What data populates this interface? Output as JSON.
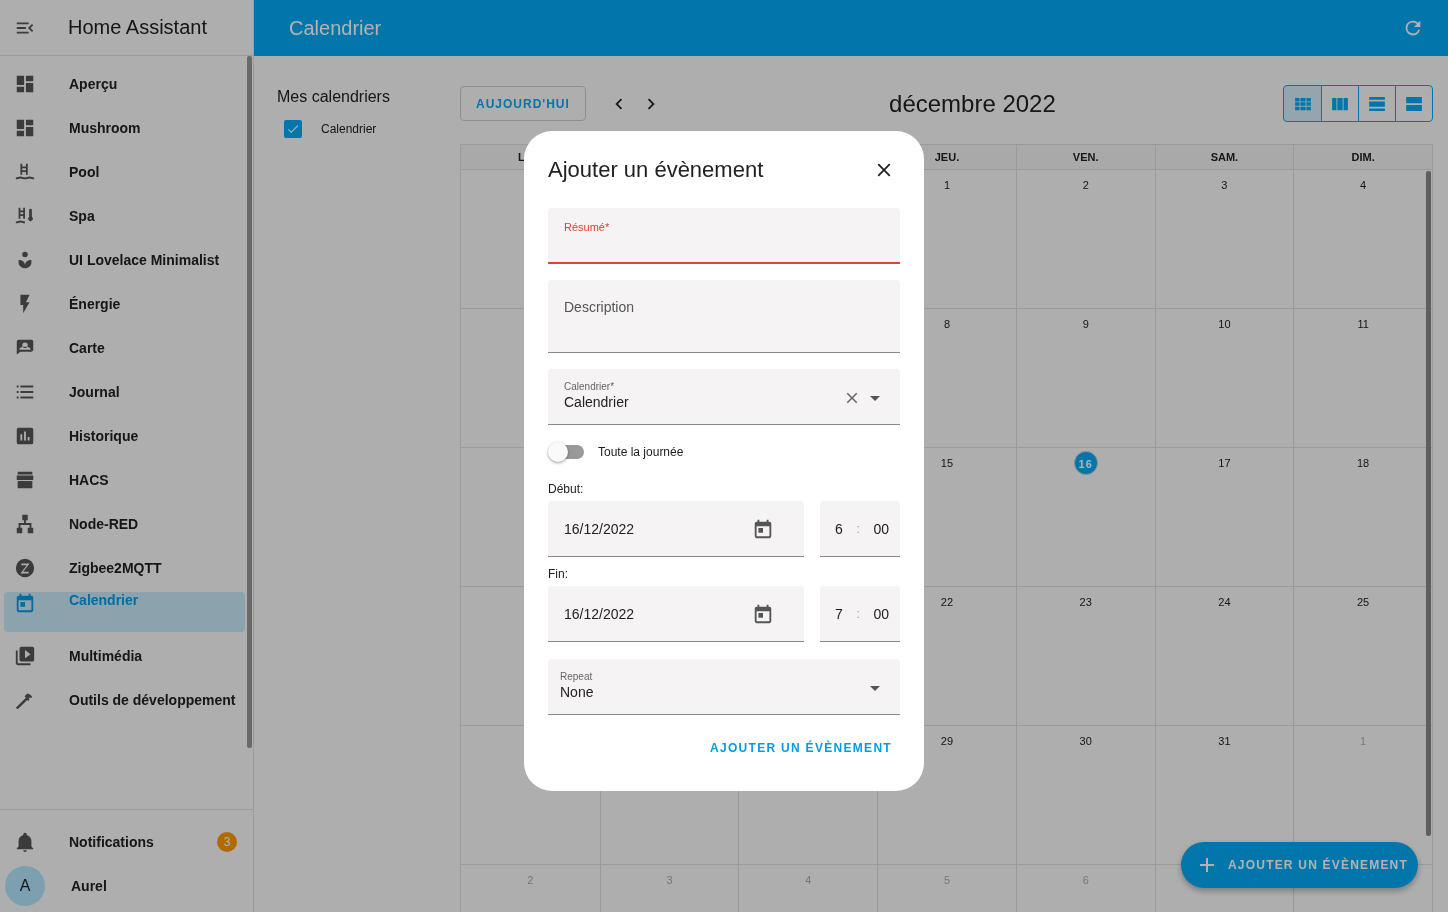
{
  "sidebar": {
    "title": "Home Assistant",
    "items": [
      {
        "label": "Aperçu",
        "selected": false
      },
      {
        "label": "Mushroom",
        "selected": false
      },
      {
        "label": "Pool",
        "selected": false
      },
      {
        "label": "Spa",
        "selected": false
      },
      {
        "label": "UI Lovelace Minimalist",
        "selected": false
      },
      {
        "label": "Énergie",
        "selected": false
      },
      {
        "label": "Carte",
        "selected": false
      },
      {
        "label": "Journal",
        "selected": false
      },
      {
        "label": "Historique",
        "selected": false
      },
      {
        "label": "HACS",
        "selected": false
      },
      {
        "label": "Node-RED",
        "selected": false
      },
      {
        "label": "Zigbee2MQTT",
        "selected": false
      },
      {
        "label": "Calendrier",
        "selected": true
      },
      {
        "label": "Multimédia",
        "selected": false
      },
      {
        "label": "Outils de développement",
        "selected": false
      }
    ],
    "notifications": {
      "label": "Notifications",
      "badge": "3"
    },
    "user": {
      "label": "Aurel",
      "initial": "A"
    }
  },
  "topbar": {
    "title": "Calendrier"
  },
  "calendars": {
    "heading": "Mes calendriers",
    "items": [
      {
        "label": "Calendrier",
        "checked": true
      }
    ]
  },
  "toolbar": {
    "today_button": "AUJOURD'HUI",
    "month_title": "décembre 2022",
    "views": [
      {
        "kind": "month",
        "selected": true
      },
      {
        "kind": "week",
        "selected": false
      },
      {
        "kind": "day",
        "selected": false
      },
      {
        "kind": "list",
        "selected": false
      }
    ]
  },
  "calendar": {
    "weekdays": [
      "L",
      "JEU.",
      "VEN.",
      "SAM.",
      "DIM."
    ],
    "weeks": [
      {
        "kind": "covered_start",
        "days": [
          {
            "day": "1",
            "today": false,
            "other_month": false
          },
          {
            "day": "2",
            "today": false,
            "other_month": false
          },
          {
            "day": "3",
            "today": false,
            "other_month": false
          },
          {
            "day": "4",
            "today": false,
            "other_month": false
          }
        ]
      },
      {
        "kind": "covered_start",
        "days": [
          {
            "day": "8",
            "today": false,
            "other_month": false
          },
          {
            "day": "9",
            "today": false,
            "other_month": false
          },
          {
            "day": "10",
            "today": false,
            "other_month": false
          },
          {
            "day": "11",
            "today": false,
            "other_month": false
          }
        ]
      },
      {
        "kind": "covered_start",
        "days": [
          {
            "day": "15",
            "today": false,
            "other_month": false
          },
          {
            "day": "16",
            "today": true,
            "other_month": false
          },
          {
            "day": "17",
            "today": false,
            "other_month": false
          },
          {
            "day": "18",
            "today": false,
            "other_month": false
          }
        ]
      },
      {
        "kind": "covered_start",
        "days": [
          {
            "day": "22",
            "today": false,
            "other_month": false
          },
          {
            "day": "23",
            "today": false,
            "other_month": false
          },
          {
            "day": "24",
            "today": false,
            "other_month": false
          },
          {
            "day": "25",
            "today": false,
            "other_month": false
          }
        ]
      },
      {
        "kind": "covered_start",
        "days": [
          {
            "day": "29",
            "today": false,
            "other_month": false
          },
          {
            "day": "30",
            "today": false,
            "other_month": false
          },
          {
            "day": "31",
            "today": false,
            "other_month": false
          },
          {
            "day": "1",
            "today": false,
            "other_month": true
          }
        ]
      },
      {
        "kind": "covered_end",
        "days": [
          {
            "day": "2",
            "today": false,
            "other_month": true
          },
          {
            "day": "3",
            "today": false,
            "other_month": true
          },
          {
            "day": "4",
            "today": false,
            "other_month": true
          },
          {
            "day": "5",
            "today": false,
            "other_month": true
          },
          {
            "day": "6",
            "today": false,
            "other_month": true
          }
        ]
      }
    ]
  },
  "fab": {
    "label": "AJOUTER UN ÉVÈNEMENT"
  },
  "dialog": {
    "title": "Ajouter un évènement",
    "summary": {
      "label": "Résumé*",
      "invalid": true
    },
    "description": {
      "label": "Description"
    },
    "calendar": {
      "label": "Calendrier*",
      "value": "Calendrier"
    },
    "all_day": {
      "label": "Toute la journée",
      "on": false
    },
    "start": {
      "label": "Début:",
      "date": "16/12/2022",
      "hours": "6",
      "separator": ":",
      "minutes": "00"
    },
    "end": {
      "label": "Fin:",
      "date": "16/12/2022",
      "hours": "7",
      "separator": ":",
      "minutes": "00"
    },
    "repeat": {
      "label": "Repeat",
      "value": "None"
    },
    "submit": "AJOUTER UN ÉVÈNEMENT"
  }
}
